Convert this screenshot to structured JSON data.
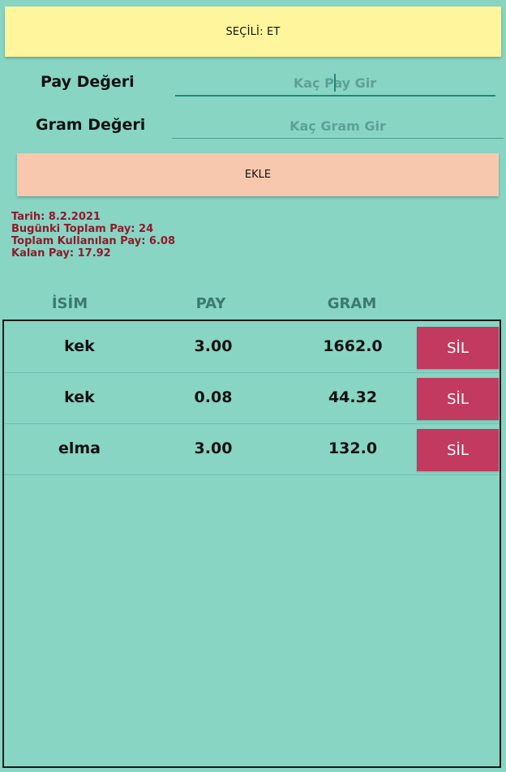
{
  "colors": {
    "background": "#88d5c4",
    "selected_bar": "#fff59d",
    "add_button": "#f8c8ae",
    "info_text": "#8e1b2a",
    "delete_button": "#c23a5f",
    "input_line": "#1d8a7a"
  },
  "selected_label": "SEÇİLİ: ET",
  "form": {
    "pay": {
      "label": "Pay Değeri",
      "placeholder": "Kaç Pay Gir",
      "value": ""
    },
    "gram": {
      "label": "Gram Değeri",
      "placeholder": "Kaç Gram Gir",
      "value": ""
    },
    "add_label": "EKLE"
  },
  "info": {
    "date": "Tarih: 8.2.2021",
    "total_today": "Bugünki Toplam Pay: 24",
    "total_used": "Toplam Kullanılan Pay: 6.08",
    "remaining": "Kalan Pay: 17.92"
  },
  "table": {
    "headers": {
      "name": "İSİM",
      "pay": "PAY",
      "gram": "GRAM"
    },
    "rows": [
      {
        "name": "kek",
        "pay": "3.00",
        "gram": "1662.0",
        "delete_label": "SİL"
      },
      {
        "name": "kek",
        "pay": "0.08",
        "gram": "44.32",
        "delete_label": "SİL"
      },
      {
        "name": "elma",
        "pay": "3.00",
        "gram": "132.0",
        "delete_label": "SİL"
      }
    ]
  }
}
